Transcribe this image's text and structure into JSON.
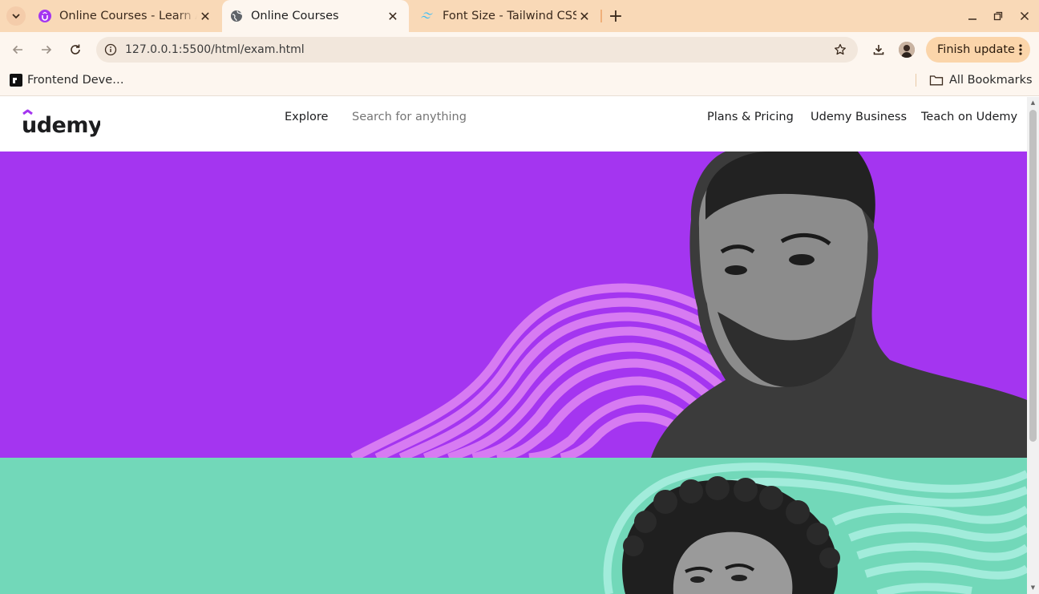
{
  "browser": {
    "tabs": [
      {
        "title": "Online Courses - Learn Anything"
      },
      {
        "title": "Online Courses"
      },
      {
        "title": "Font Size - Tailwind CSS"
      }
    ],
    "url": "127.0.0.1:5500/html/exam.html",
    "finish_update_label": "Finish update",
    "bookmarks": [
      {
        "label": "Frontend Deve…"
      }
    ],
    "all_bookmarks_label": "All Bookmarks"
  },
  "site": {
    "logo_text": "udemy",
    "nav": {
      "explore": "Explore",
      "plans": "Plans & Pricing",
      "business": "Udemy Business",
      "teach": "Teach on Udemy"
    },
    "search_placeholder": "Search for anything"
  },
  "colors": {
    "hero_purple": "#a435f0",
    "hero_teal": "#72d8b9",
    "brand_purple": "#a435f0",
    "chrome_tab_bar": "#f9d9b7"
  },
  "icons": [
    "tab-search-icon",
    "udemy-favicon",
    "globe-icon",
    "tailwind-icon",
    "close-icon",
    "plus-icon",
    "minimize-icon",
    "maximize-icon",
    "close-window-icon",
    "back-icon",
    "forward-icon",
    "reload-icon",
    "site-info-icon",
    "star-icon",
    "download-icon",
    "more-vert-icon",
    "bookmark-favicon",
    "folder-icon"
  ]
}
